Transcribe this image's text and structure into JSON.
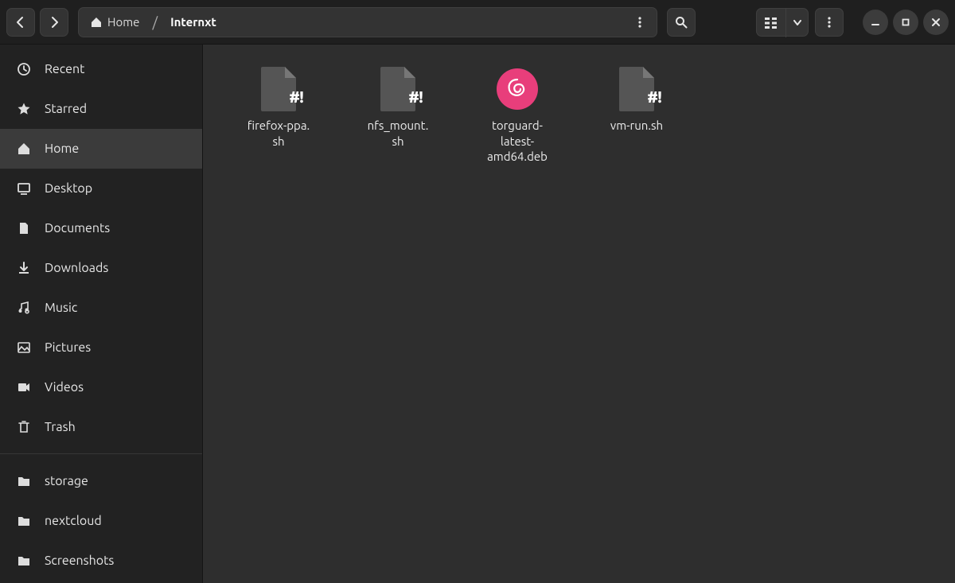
{
  "breadcrumb": {
    "home_label": "Home",
    "current": "Internxt"
  },
  "sidebar": {
    "items": [
      {
        "icon": "clock-icon",
        "label": "Recent"
      },
      {
        "icon": "star-icon",
        "label": "Starred"
      },
      {
        "icon": "home-icon",
        "label": "Home",
        "active": true
      },
      {
        "icon": "desktop-icon",
        "label": "Desktop"
      },
      {
        "icon": "document-icon",
        "label": "Documents"
      },
      {
        "icon": "download-icon",
        "label": "Downloads"
      },
      {
        "icon": "music-icon",
        "label": "Music"
      },
      {
        "icon": "pictures-icon",
        "label": "Pictures"
      },
      {
        "icon": "videos-icon",
        "label": "Videos"
      },
      {
        "icon": "trash-icon",
        "label": "Trash"
      }
    ],
    "bookmarks": [
      {
        "label": "storage"
      },
      {
        "label": "nextcloud"
      },
      {
        "label": "Screenshots"
      }
    ]
  },
  "files": [
    {
      "type": "shell",
      "name": "firefox-ppa.\nsh"
    },
    {
      "type": "shell",
      "name": "nfs_mount.\nsh"
    },
    {
      "type": "deb",
      "name": "torguard-\nlatest-\namd64.deb"
    },
    {
      "type": "shell",
      "name": "vm-run.sh"
    }
  ]
}
